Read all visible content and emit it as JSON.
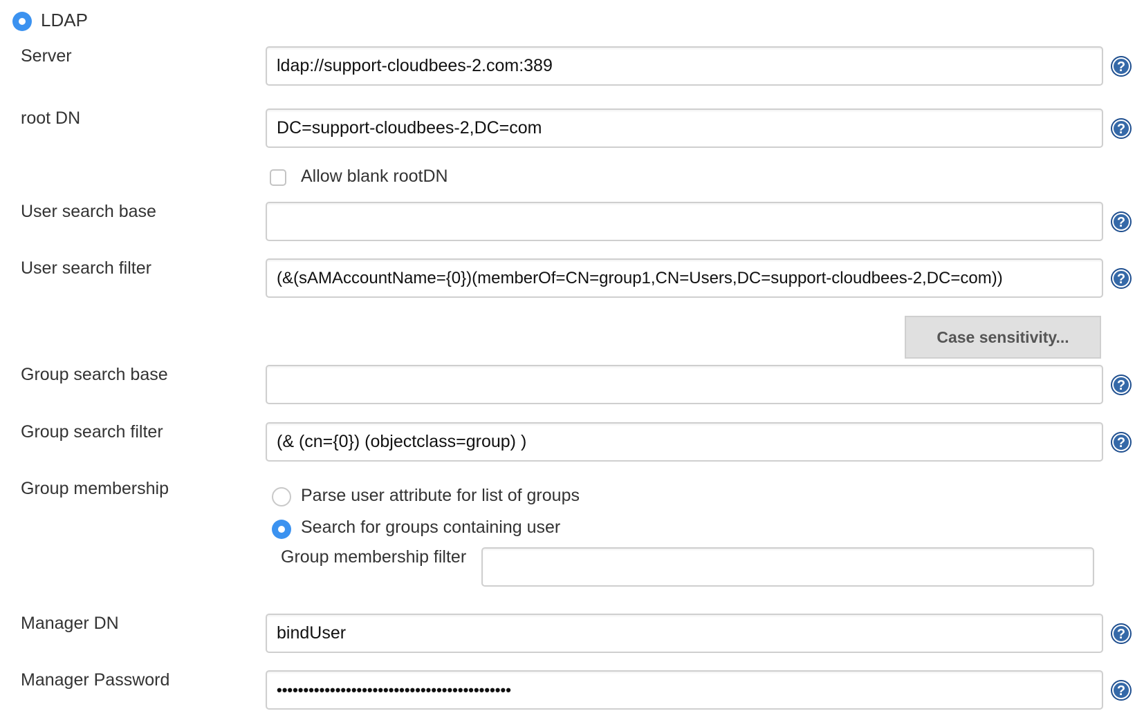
{
  "security_realm": {
    "label": "LDAP",
    "selected": true
  },
  "fields": {
    "server": {
      "label": "Server",
      "value": "ldap://support-cloudbees-2.com:389"
    },
    "root_dn": {
      "label": "root DN",
      "value": "DC=support-cloudbees-2,DC=com"
    },
    "allow_blank_root_dn": {
      "label": "Allow blank rootDN",
      "checked": false
    },
    "user_search_base": {
      "label": "User search base",
      "value": ""
    },
    "user_search_filter": {
      "label": "User search filter",
      "value": "(&(sAMAccountName={0})(memberOf=CN=group1,CN=Users,DC=support-cloudbees-2,DC=com))"
    },
    "case_sensitivity_button": "Case sensitivity...",
    "group_search_base": {
      "label": "Group search base",
      "value": ""
    },
    "group_search_filter": {
      "label": "Group search filter",
      "value": "(& (cn={0}) (objectclass=group) )"
    },
    "group_membership": {
      "label": "Group membership",
      "options": [
        {
          "label": "Parse user attribute for list of groups",
          "selected": false
        },
        {
          "label": "Search for groups containing user",
          "selected": true
        }
      ],
      "filter_label": "Group membership filter",
      "filter_value": ""
    },
    "manager_dn": {
      "label": "Manager DN",
      "value": "bindUser"
    },
    "manager_password": {
      "label": "Manager Password",
      "value": "••••••••••••••••••••••••••••••••••••••••••••"
    }
  },
  "icons": {
    "help": "help-icon",
    "accent": "#3b92f0"
  }
}
